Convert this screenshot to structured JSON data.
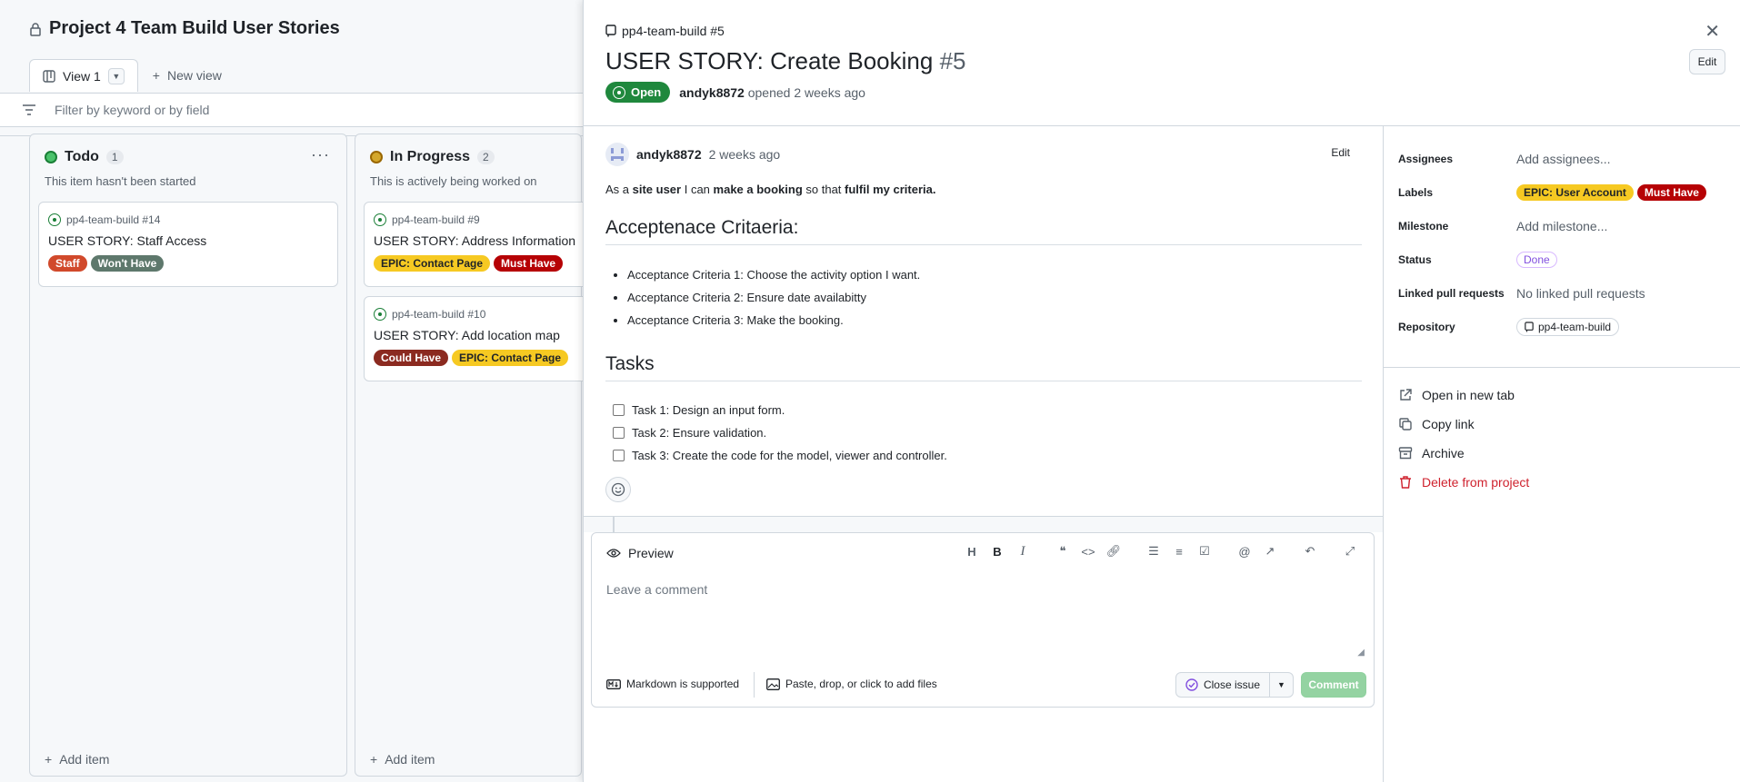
{
  "project": {
    "title": "Project 4 Team Build User Stories",
    "view_tab": "View 1",
    "new_view": "New view",
    "filter_placeholder": "Filter by keyword or by field"
  },
  "columns": [
    {
      "name": "Todo",
      "count": "1",
      "description": "This item hasn't been started",
      "status_color": "#1a7f37",
      "add_item": "Add item",
      "cards": [
        {
          "ref": "pp4-team-build #14",
          "title": "USER STORY: Staff Access",
          "labels": [
            {
              "text": "Staff",
              "bg": "#d1492b",
              "fg": "#ffffff"
            },
            {
              "text": "Won't Have",
              "bg": "#5e786c",
              "fg": "#ffffff"
            }
          ]
        }
      ]
    },
    {
      "name": "In Progress",
      "count": "2",
      "description": "This is actively being worked on",
      "status_color": "#bf8700",
      "add_item": "Add item",
      "cards": [
        {
          "ref": "pp4-team-build #9",
          "title": "USER STORY: Address Information",
          "labels": [
            {
              "text": "EPIC: Contact Page",
              "bg": "#f6c922",
              "fg": "#1f2328"
            },
            {
              "text": "Must Have",
              "bg": "#b60205",
              "fg": "#ffffff"
            }
          ]
        },
        {
          "ref": "pp4-team-build #10",
          "title": "USER STORY: Add location map",
          "labels": [
            {
              "text": "Could Have",
              "bg": "#8b2a20",
              "fg": "#ffffff"
            },
            {
              "text": "EPIC: Contact Page",
              "bg": "#f6c922",
              "fg": "#1f2328"
            }
          ]
        }
      ]
    }
  ],
  "issue": {
    "repo_ref": "pp4-team-build #5",
    "title": "USER STORY: Create Booking",
    "number": "#5",
    "state": "Open",
    "author": "andyk8872",
    "opened_text": "opened 2 weeks ago",
    "edit_label": "Edit",
    "comment": {
      "author": "andyk8872",
      "time": "2 weeks ago",
      "edit_label": "Edit",
      "body": {
        "p1": "As a ",
        "b1": "site user",
        "p2": " I can ",
        "b2": "make a booking",
        "p3": " so that ",
        "b3": "fulfil my criteria."
      },
      "heading1": "Acceptenace Critaeria:",
      "criteria": [
        "Acceptance Criteria 1: Choose the activity option I want.",
        "Acceptance Criteria 2: Ensure date availabitty",
        "Acceptance Criteria 3: Make the booking."
      ],
      "heading2": "Tasks",
      "tasks": [
        "Task 1: Design an input form.",
        "Task 2: Ensure validation.",
        "Task 3: Create the code for the model, viewer and controller."
      ]
    },
    "composer": {
      "tab": "Preview",
      "placeholder": "Leave a comment",
      "markdown_note": "Markdown is supported",
      "attach_note": "Paste, drop, or click to add files",
      "close_issue": "Close issue",
      "comment_btn": "Comment"
    }
  },
  "sidebar": {
    "assignees_label": "Assignees",
    "assignees_value": "Add assignees...",
    "labels_label": "Labels",
    "labels": [
      {
        "text": "EPIC: User Account",
        "bg": "#f6c922",
        "fg": "#1f2328"
      },
      {
        "text": "Must Have",
        "bg": "#b60205",
        "fg": "#ffffff"
      }
    ],
    "milestone_label": "Milestone",
    "milestone_value": "Add milestone...",
    "status_label": "Status",
    "status_value": "Done",
    "linked_label": "Linked pull requests",
    "linked_value": "No linked pull requests",
    "repo_label": "Repository",
    "repo_value": "pp4-team-build",
    "actions": {
      "open_new_tab": "Open in new tab",
      "copy_link": "Copy link",
      "archive": "Archive",
      "delete": "Delete from project"
    }
  }
}
